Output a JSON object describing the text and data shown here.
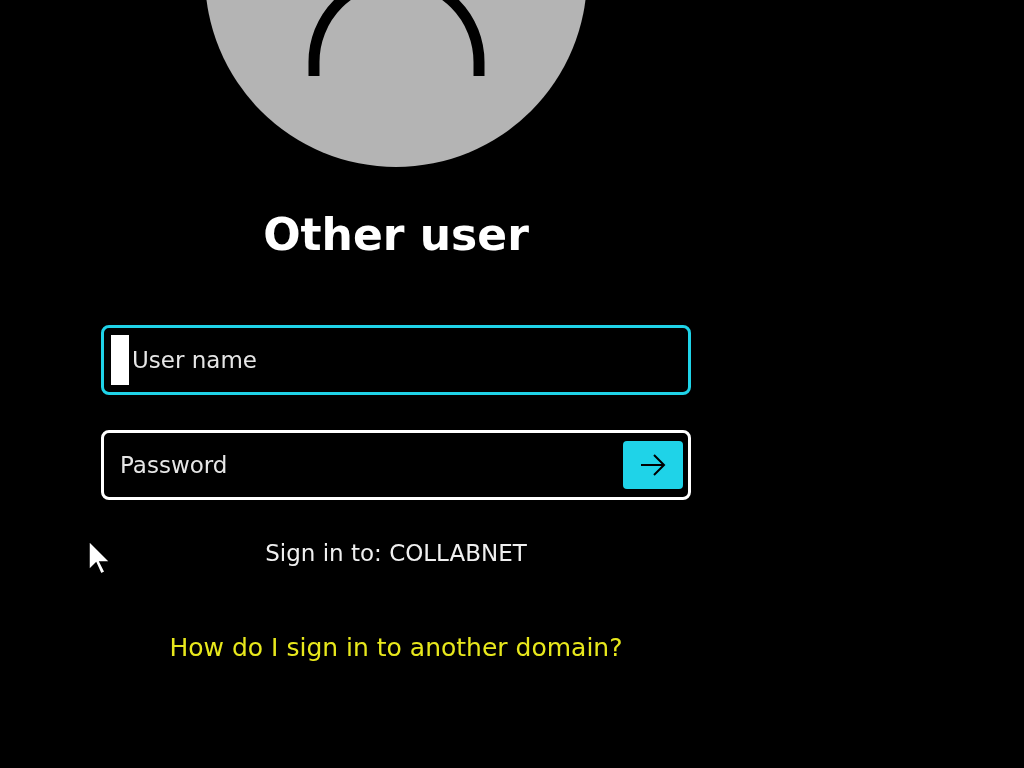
{
  "title": "Other user",
  "fields": [
    {
      "placeholder": "User name",
      "focused": true,
      "caret": true,
      "submit": false
    },
    {
      "placeholder": "Password",
      "focused": false,
      "caret": false,
      "submit": true
    }
  ],
  "sign_in_to": "Sign in to: COLLABNET",
  "help_link": "How do I sign in to another domain?"
}
